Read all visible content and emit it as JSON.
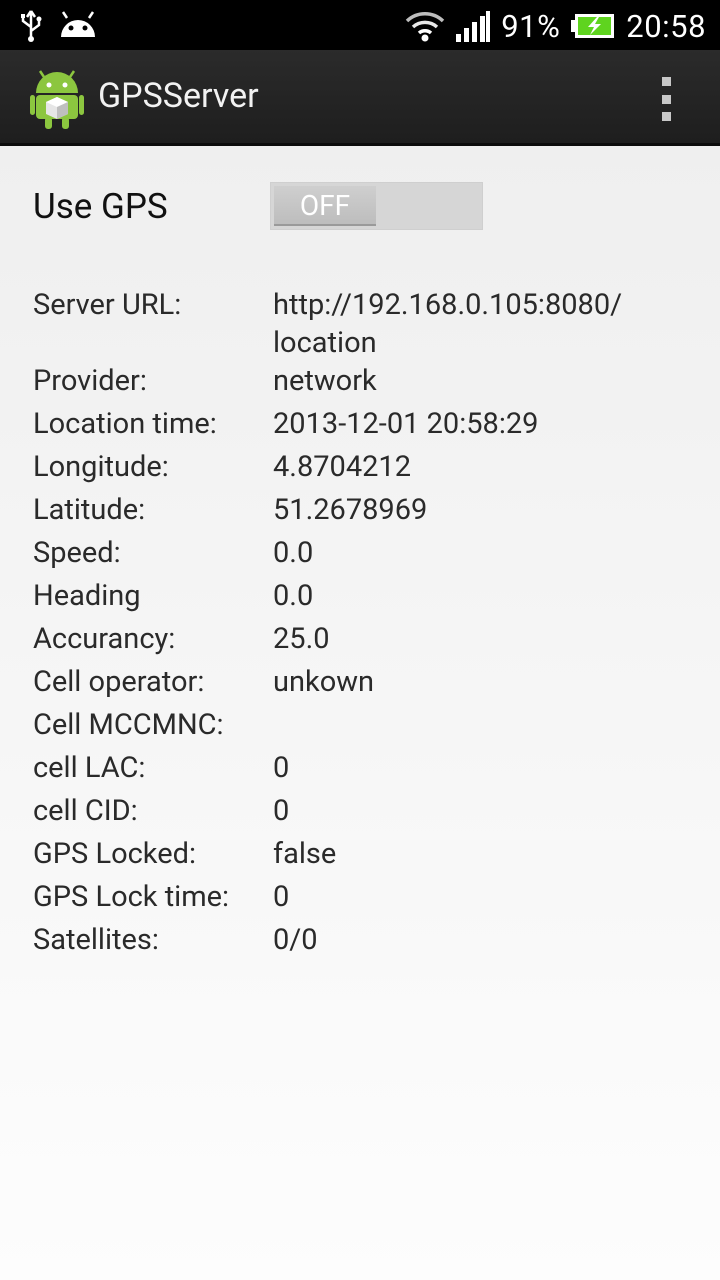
{
  "status_bar": {
    "battery_percent": "91%",
    "time": "20:58",
    "icons": [
      "usb-icon",
      "android-icon",
      "wifi-icon",
      "signal-icon",
      "battery-charging-icon"
    ]
  },
  "action_bar": {
    "title": "GPSServer",
    "icons": [
      "app-icon",
      "overflow-menu-icon"
    ]
  },
  "gps_toggle": {
    "label": "Use GPS",
    "state": "OFF"
  },
  "info_rows": [
    {
      "label": "Server URL:",
      "value": "http://192.168.0.105:8080/\nlocation"
    },
    {
      "label": "Provider:",
      "value": "network"
    },
    {
      "label": "Location time:",
      "value": "2013-12-01 20:58:29"
    },
    {
      "label": "Longitude:",
      "value": "4.8704212"
    },
    {
      "label": "Latitude:",
      "value": "51.2678969"
    },
    {
      "label": "Speed:",
      "value": "0.0"
    },
    {
      "label": "Heading",
      "value": "0.0"
    },
    {
      "label": "Accurancy:",
      "value": "25.0"
    },
    {
      "label": "Cell operator:",
      "value": "unkown"
    },
    {
      "label": "Cell MCCMNC:",
      "value": ""
    },
    {
      "label": "cell LAC:",
      "value": "0"
    },
    {
      "label": "cell CID:",
      "value": "0"
    },
    {
      "label": "GPS Locked:",
      "value": "false"
    },
    {
      "label": "GPS Lock time:",
      "value": "0"
    },
    {
      "label": "Satellites:",
      "value": "0/0"
    }
  ],
  "colors": {
    "battery_green": "#5fd41f",
    "action_bar": "#262626",
    "toggle_off": "#bdbdbd"
  }
}
